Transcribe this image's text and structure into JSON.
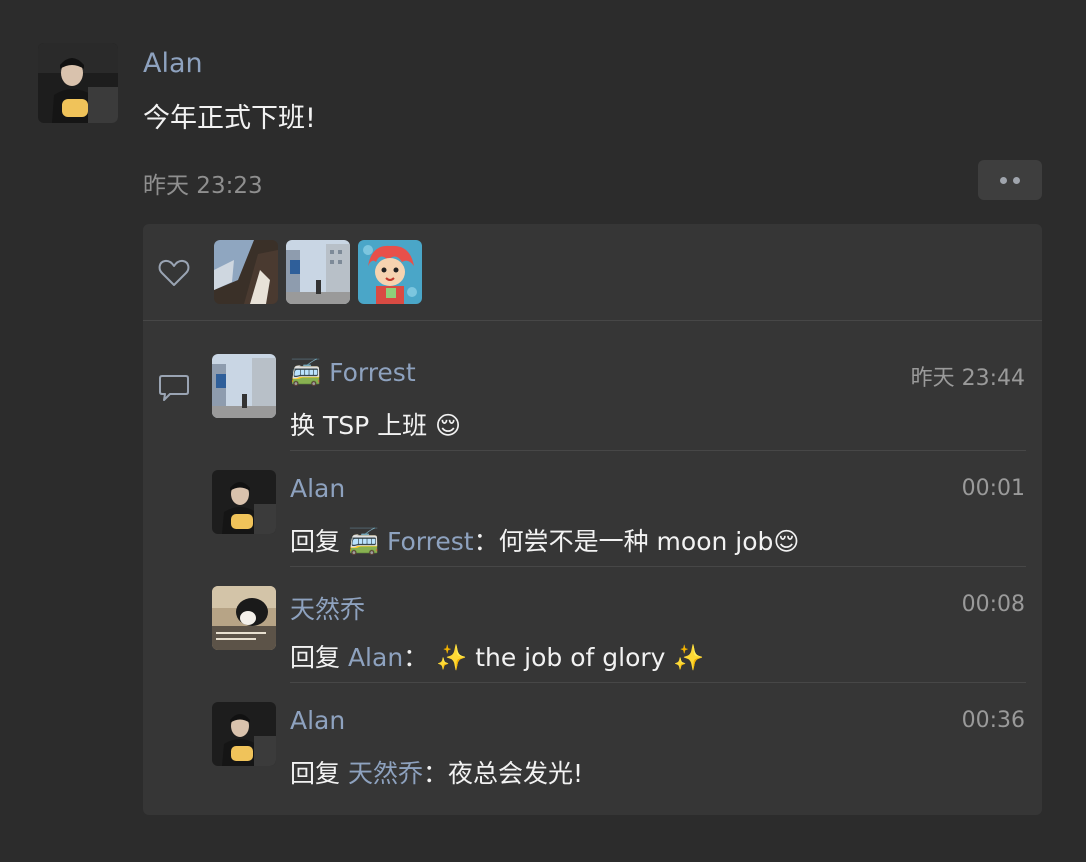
{
  "post": {
    "author": "Alan",
    "text": "今年正式下班!",
    "time": "昨天 23:23"
  },
  "likes": {
    "icon": "heart-icon",
    "avatars": [
      "avatar-car-window",
      "avatar-street",
      "avatar-ponyo"
    ]
  },
  "comments": [
    {
      "author": "🚎 Forrest",
      "time": "昨天 23:44",
      "text": "换 TSP 上班 😌"
    },
    {
      "author": "Alan",
      "time": "00:01",
      "reply_prefix": "回复 ",
      "reply_to": "🚎 Forrest",
      "reply_text": "：何尝不是一种 moon job😌"
    },
    {
      "author": "天然乔",
      "time": "00:08",
      "reply_prefix": "回复 ",
      "reply_to": "Alan",
      "reply_text": "： ✨ the job of glory ✨"
    },
    {
      "author": "Alan",
      "time": "00:36",
      "reply_prefix": "回复 ",
      "reply_to": "天然乔",
      "reply_text": "：夜总会发光!"
    }
  ],
  "colors": {
    "background": "#2c2c2c",
    "panel": "#363636",
    "link_name": "#8ea2bf",
    "text": "#f2f2f2",
    "muted": "#9a9a9a"
  }
}
